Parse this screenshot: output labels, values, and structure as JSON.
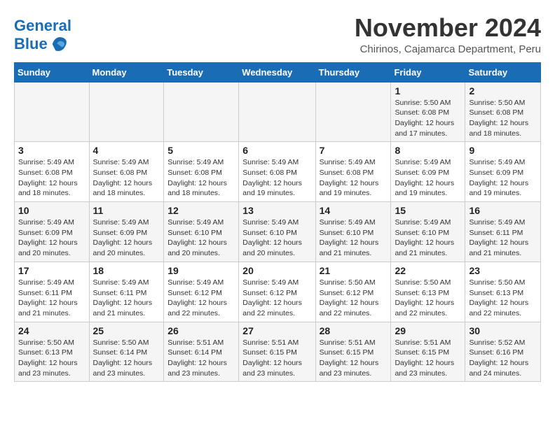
{
  "header": {
    "logo_line1": "General",
    "logo_line2": "Blue",
    "month": "November 2024",
    "location": "Chirinos, Cajamarca Department, Peru"
  },
  "weekdays": [
    "Sunday",
    "Monday",
    "Tuesday",
    "Wednesday",
    "Thursday",
    "Friday",
    "Saturday"
  ],
  "weeks": [
    [
      {
        "day": "",
        "info": ""
      },
      {
        "day": "",
        "info": ""
      },
      {
        "day": "",
        "info": ""
      },
      {
        "day": "",
        "info": ""
      },
      {
        "day": "",
        "info": ""
      },
      {
        "day": "1",
        "info": "Sunrise: 5:50 AM\nSunset: 6:08 PM\nDaylight: 12 hours and 17 minutes."
      },
      {
        "day": "2",
        "info": "Sunrise: 5:50 AM\nSunset: 6:08 PM\nDaylight: 12 hours and 18 minutes."
      }
    ],
    [
      {
        "day": "3",
        "info": "Sunrise: 5:49 AM\nSunset: 6:08 PM\nDaylight: 12 hours and 18 minutes."
      },
      {
        "day": "4",
        "info": "Sunrise: 5:49 AM\nSunset: 6:08 PM\nDaylight: 12 hours and 18 minutes."
      },
      {
        "day": "5",
        "info": "Sunrise: 5:49 AM\nSunset: 6:08 PM\nDaylight: 12 hours and 18 minutes."
      },
      {
        "day": "6",
        "info": "Sunrise: 5:49 AM\nSunset: 6:08 PM\nDaylight: 12 hours and 19 minutes."
      },
      {
        "day": "7",
        "info": "Sunrise: 5:49 AM\nSunset: 6:08 PM\nDaylight: 12 hours and 19 minutes."
      },
      {
        "day": "8",
        "info": "Sunrise: 5:49 AM\nSunset: 6:09 PM\nDaylight: 12 hours and 19 minutes."
      },
      {
        "day": "9",
        "info": "Sunrise: 5:49 AM\nSunset: 6:09 PM\nDaylight: 12 hours and 19 minutes."
      }
    ],
    [
      {
        "day": "10",
        "info": "Sunrise: 5:49 AM\nSunset: 6:09 PM\nDaylight: 12 hours and 20 minutes."
      },
      {
        "day": "11",
        "info": "Sunrise: 5:49 AM\nSunset: 6:09 PM\nDaylight: 12 hours and 20 minutes."
      },
      {
        "day": "12",
        "info": "Sunrise: 5:49 AM\nSunset: 6:10 PM\nDaylight: 12 hours and 20 minutes."
      },
      {
        "day": "13",
        "info": "Sunrise: 5:49 AM\nSunset: 6:10 PM\nDaylight: 12 hours and 20 minutes."
      },
      {
        "day": "14",
        "info": "Sunrise: 5:49 AM\nSunset: 6:10 PM\nDaylight: 12 hours and 21 minutes."
      },
      {
        "day": "15",
        "info": "Sunrise: 5:49 AM\nSunset: 6:10 PM\nDaylight: 12 hours and 21 minutes."
      },
      {
        "day": "16",
        "info": "Sunrise: 5:49 AM\nSunset: 6:11 PM\nDaylight: 12 hours and 21 minutes."
      }
    ],
    [
      {
        "day": "17",
        "info": "Sunrise: 5:49 AM\nSunset: 6:11 PM\nDaylight: 12 hours and 21 minutes."
      },
      {
        "day": "18",
        "info": "Sunrise: 5:49 AM\nSunset: 6:11 PM\nDaylight: 12 hours and 21 minutes."
      },
      {
        "day": "19",
        "info": "Sunrise: 5:49 AM\nSunset: 6:12 PM\nDaylight: 12 hours and 22 minutes."
      },
      {
        "day": "20",
        "info": "Sunrise: 5:49 AM\nSunset: 6:12 PM\nDaylight: 12 hours and 22 minutes."
      },
      {
        "day": "21",
        "info": "Sunrise: 5:50 AM\nSunset: 6:12 PM\nDaylight: 12 hours and 22 minutes."
      },
      {
        "day": "22",
        "info": "Sunrise: 5:50 AM\nSunset: 6:13 PM\nDaylight: 12 hours and 22 minutes."
      },
      {
        "day": "23",
        "info": "Sunrise: 5:50 AM\nSunset: 6:13 PM\nDaylight: 12 hours and 22 minutes."
      }
    ],
    [
      {
        "day": "24",
        "info": "Sunrise: 5:50 AM\nSunset: 6:13 PM\nDaylight: 12 hours and 23 minutes."
      },
      {
        "day": "25",
        "info": "Sunrise: 5:50 AM\nSunset: 6:14 PM\nDaylight: 12 hours and 23 minutes."
      },
      {
        "day": "26",
        "info": "Sunrise: 5:51 AM\nSunset: 6:14 PM\nDaylight: 12 hours and 23 minutes."
      },
      {
        "day": "27",
        "info": "Sunrise: 5:51 AM\nSunset: 6:15 PM\nDaylight: 12 hours and 23 minutes."
      },
      {
        "day": "28",
        "info": "Sunrise: 5:51 AM\nSunset: 6:15 PM\nDaylight: 12 hours and 23 minutes."
      },
      {
        "day": "29",
        "info": "Sunrise: 5:51 AM\nSunset: 6:15 PM\nDaylight: 12 hours and 23 minutes."
      },
      {
        "day": "30",
        "info": "Sunrise: 5:52 AM\nSunset: 6:16 PM\nDaylight: 12 hours and 24 minutes."
      }
    ]
  ]
}
